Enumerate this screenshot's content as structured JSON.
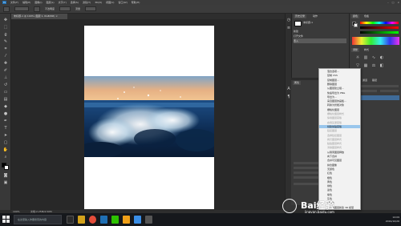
{
  "menubar": {
    "app_icon": "Ps",
    "items": [
      "文件(F)",
      "编辑(E)",
      "图像(I)",
      "图层(L)",
      "文字(Y)",
      "选择(S)",
      "滤镜(T)",
      "3D(D)",
      "视图(V)",
      "窗口(W)",
      "帮助(H)"
    ],
    "window_controls": [
      "–",
      "□",
      "×"
    ]
  },
  "optionsbar": {
    "fields": [
      "不透明度",
      "流量"
    ]
  },
  "tabbar": {
    "document_tab": "未标题-1 @ 100% (图层 1, RGB/8#) ×"
  },
  "statusbar": {
    "zoom": "100%",
    "info": "文档:2.25M/4.50M"
  },
  "history_panel": {
    "tabs": [
      "历史记录",
      "动作"
    ],
    "rows": [
      "未标题-1",
      "新建",
      "打开文件",
      "置入"
    ]
  },
  "properties_panel": {
    "tab": "属性"
  },
  "color_panel": {
    "tabs": [
      "颜色",
      "色板"
    ]
  },
  "adjust_panel": {
    "tabs": [
      "调整",
      "样式"
    ]
  },
  "layers_panel": {
    "tabs": [
      "图层",
      "通道",
      "路径"
    ],
    "rows": [
      "图层 1",
      "背景"
    ]
  },
  "context_menu": {
    "items": [
      {
        "label": "混合选项...",
        "state": "normal"
      },
      {
        "label": "复制 CSS",
        "state": "normal"
      },
      {
        "label": "复制图层...",
        "state": "normal"
      },
      {
        "label": "删除图层",
        "state": "normal"
      },
      {
        "label": "从图层建立组...",
        "state": "normal"
      },
      {
        "label": "快速导出为 PNG",
        "state": "normal"
      },
      {
        "label": "导出为...",
        "state": "normal"
      },
      {
        "label": "来自图层的画板...",
        "state": "normal"
      },
      {
        "label": "转换为智能对象",
        "state": "normal"
      },
      {
        "label": "栅格化图层",
        "state": "normal"
      },
      {
        "label": "栅格化图层样式",
        "state": "disabled"
      },
      {
        "label": "停用图层蒙版",
        "state": "disabled"
      },
      {
        "label": "启用矢量蒙版",
        "state": "disabled"
      },
      {
        "label": "创建剪贴蒙版",
        "state": "highlighted"
      },
      {
        "label": "链接图层",
        "state": "disabled"
      },
      {
        "label": "选择链接图层",
        "state": "disabled"
      },
      {
        "label": "拷贝图层样式",
        "state": "disabled"
      },
      {
        "label": "粘贴图层样式",
        "state": "disabled"
      },
      {
        "label": "清除图层样式",
        "state": "disabled"
      },
      {
        "label": "从隔离图层释放",
        "state": "normal"
      },
      {
        "label": "向下合并",
        "state": "normal"
      },
      {
        "label": "合并可见图层",
        "state": "normal"
      },
      {
        "label": "拼合图像",
        "state": "normal"
      },
      {
        "label": "无颜色",
        "state": "normal"
      },
      {
        "label": "红色",
        "state": "normal"
      },
      {
        "label": "橙色",
        "state": "normal"
      },
      {
        "label": "黄色",
        "state": "normal"
      },
      {
        "label": "绿色",
        "state": "normal"
      },
      {
        "label": "蓝色",
        "state": "normal"
      },
      {
        "label": "紫色",
        "state": "normal"
      },
      {
        "label": "灰色",
        "state": "normal"
      },
      {
        "label": "明信片",
        "state": "normal"
      },
      {
        "label": "从所选图层新建 3D 模型",
        "state": "normal"
      }
    ]
  },
  "taskbar": {
    "search_placeholder": "在这里输入你要搜索的内容",
    "time": "14:09",
    "date": "2019/10/26"
  },
  "watermark": {
    "text": "Bai经验",
    "url": "jingyan.baidu.com"
  },
  "colors": {
    "ps_blue": "#1f6fb3",
    "menu_highlight": "#99c6ec",
    "panel_bg": "#3a3a3a",
    "canvas_bg": "#282828"
  },
  "icons": [
    "photoshop-icon",
    "move-icon",
    "marquee-icon",
    "lasso-icon",
    "crop-icon",
    "brush-icon",
    "eraser-icon",
    "text-icon",
    "zoom-icon",
    "windows-start-icon",
    "search-icon",
    "chrome-icon",
    "wechat-icon",
    "folder-icon"
  ]
}
